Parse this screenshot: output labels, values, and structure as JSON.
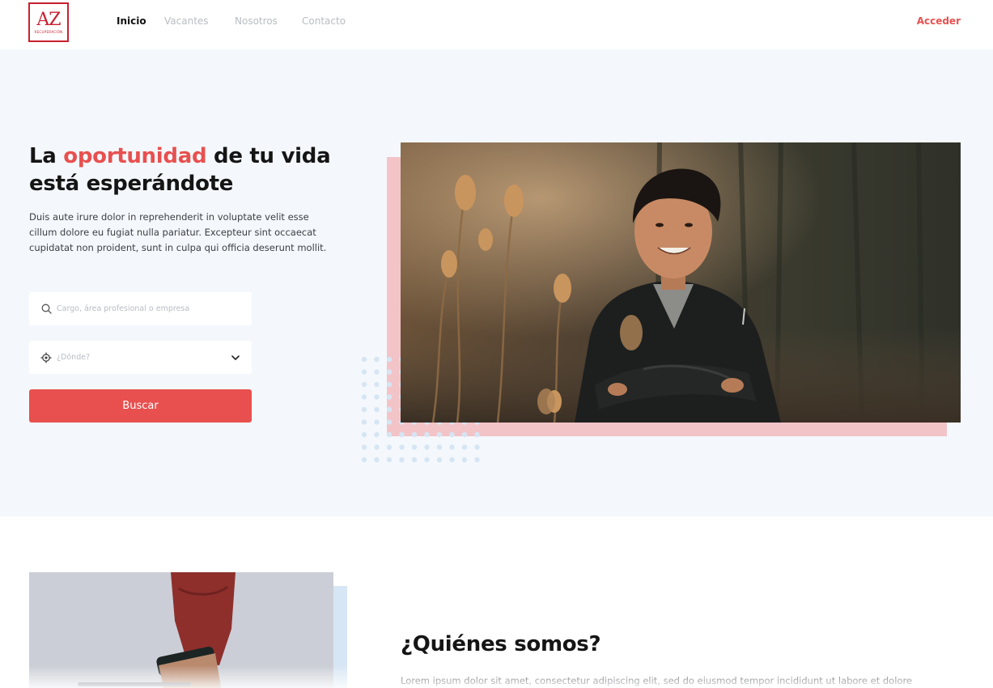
{
  "brand": {
    "logo_mark": "AZ",
    "logo_sub": "RECUPERACIÓN",
    "accent_color": "#e8504f",
    "logo_color": "#c8202e"
  },
  "nav": {
    "items": [
      {
        "label": "Inicio",
        "active": true
      },
      {
        "label": "Vacantes",
        "active": false
      },
      {
        "label": "Nosotros",
        "active": false
      },
      {
        "label": "Contacto",
        "active": false
      }
    ],
    "login_label": "Acceder"
  },
  "hero": {
    "headline_pre": "La ",
    "headline_accent": "oportunidad",
    "headline_post": " de tu vida está esperándote",
    "description": "Duis aute irure dolor in reprehenderit in voluptate velit esse cillum dolore eu fugiat nulla pariatur. Excepteur sint occaecat cupidatat non proident, sunt in culpa qui officia deserunt mollit.",
    "search_placeholder": "Cargo, área profesional o empresa",
    "location_placeholder": "¿Dónde?",
    "search_button": "Buscar",
    "background": "#f4f8fc"
  },
  "about": {
    "title": "¿Quiénes somos?",
    "text": "Lorem ipsum dolor sit amet, consectetur adipiscing elit, sed do eiusmod tempor incididunt ut labore et dolore"
  }
}
